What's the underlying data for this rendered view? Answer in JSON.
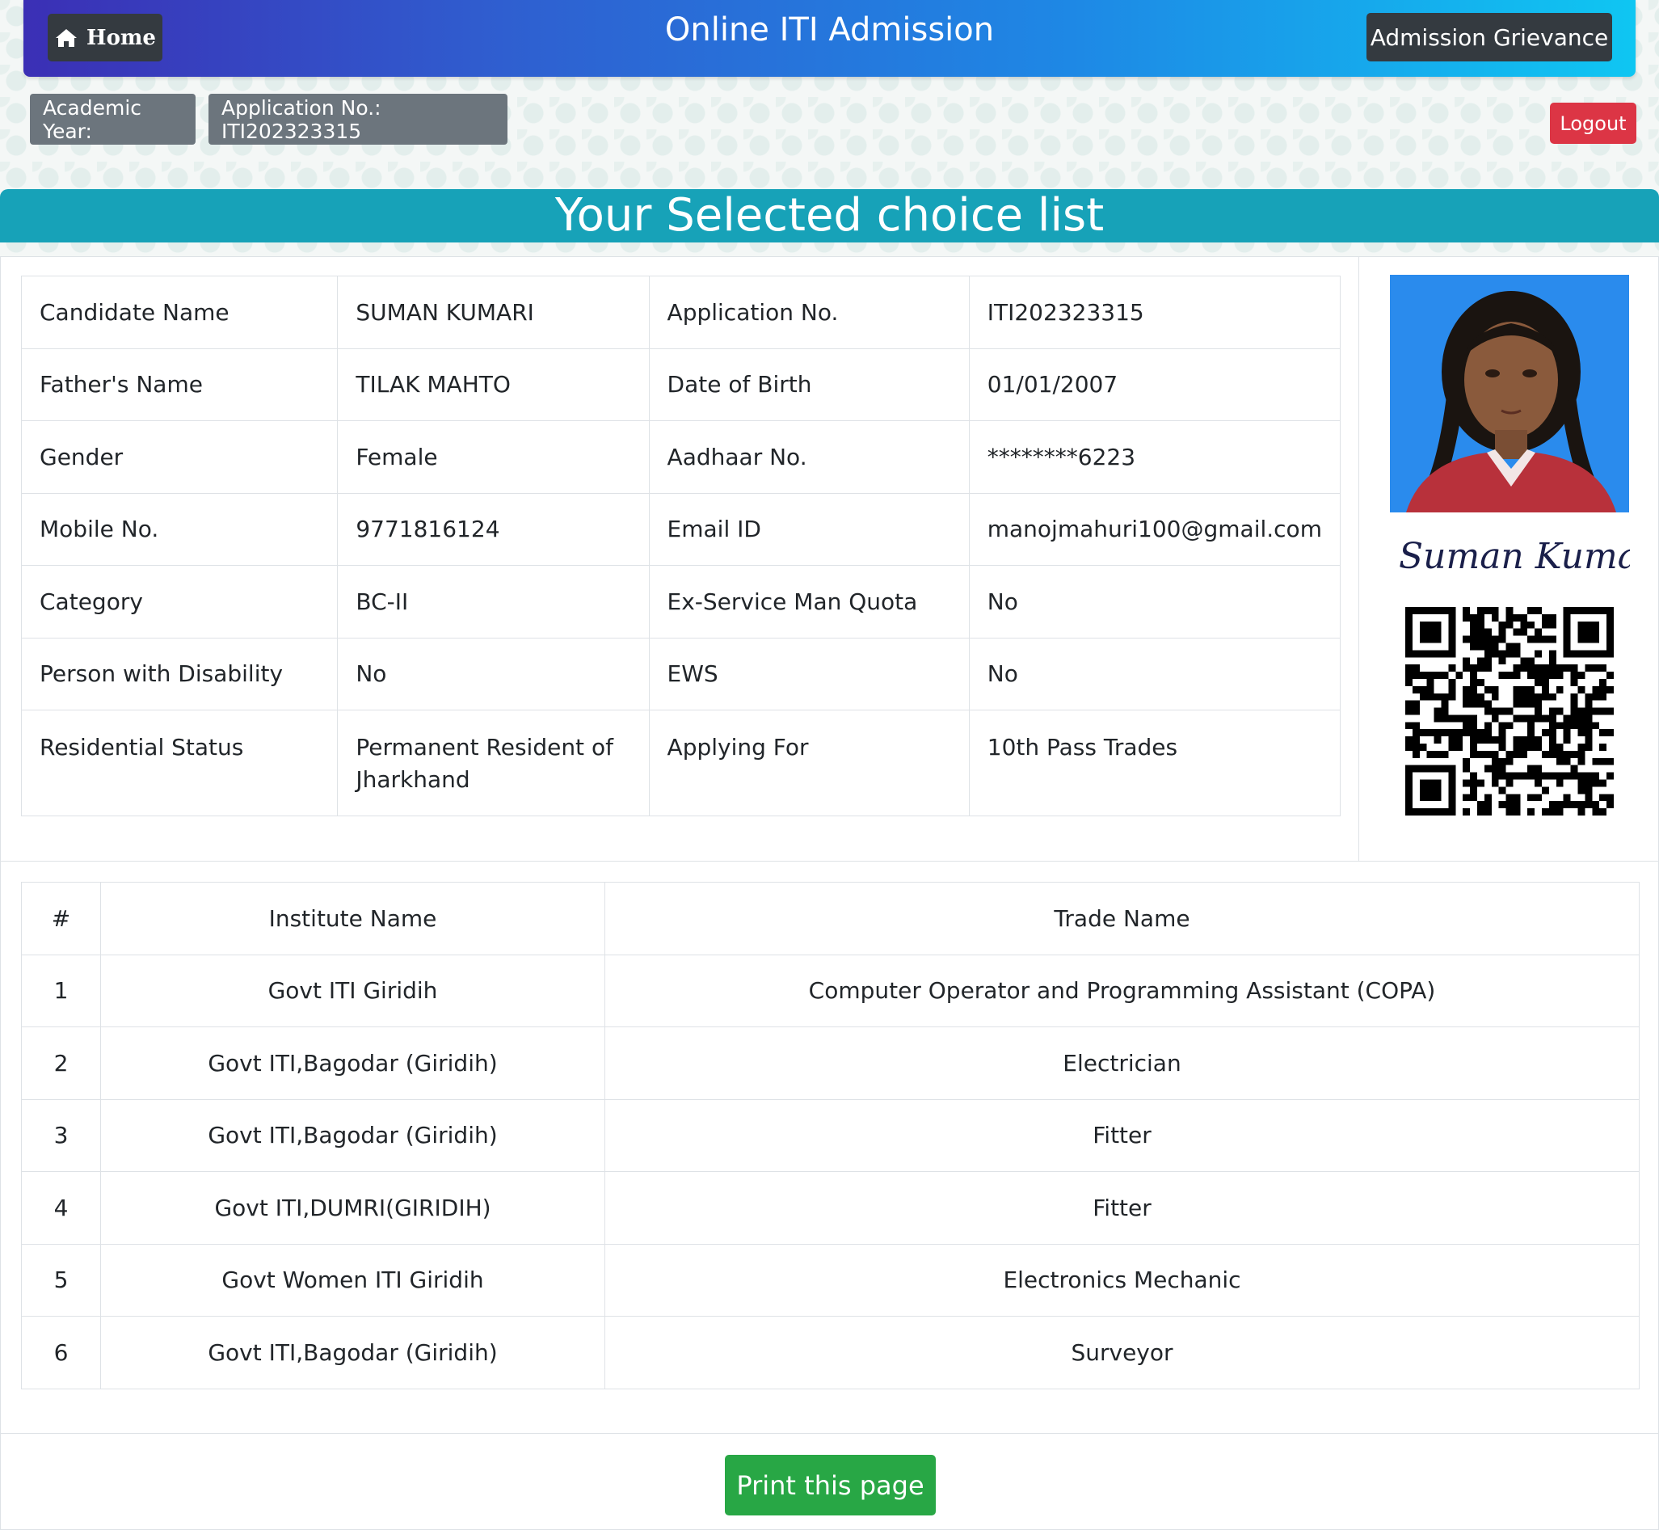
{
  "header": {
    "home_label": "Home",
    "title": "Online ITI Admission",
    "grievance_label": "Admission Grievance"
  },
  "info": {
    "academic_year": "Academic Year:",
    "application_no": "Application No.: ITI202323315",
    "logout_label": "Logout"
  },
  "banner": {
    "title": "Your Selected choice list"
  },
  "candidate": {
    "rows": [
      {
        "l1": "Candidate Name",
        "v1": "SUMAN KUMARI",
        "l2": "Application No.",
        "v2": "ITI202323315"
      },
      {
        "l1": "Father's Name",
        "v1": "TILAK MAHTO",
        "l2": "Date of Birth",
        "v2": "01/01/2007"
      },
      {
        "l1": "Gender",
        "v1": "Female",
        "l2": "Aadhaar No.",
        "v2": "********6223"
      },
      {
        "l1": "Mobile No.",
        "v1": "9771816124",
        "l2": "Email ID",
        "v2": "manojmahuri100@gmail.com"
      },
      {
        "l1": "Category",
        "v1": "BC-II",
        "l2": "Ex-Service Man Quota",
        "v2": "No"
      },
      {
        "l1": "Person with Disability",
        "v1": "No",
        "l2": "EWS",
        "v2": "No"
      },
      {
        "l1": "Residential Status",
        "v1": "Permanent Resident of Jharkhand",
        "l2": "Applying For",
        "v2": "10th Pass Trades"
      }
    ],
    "signature_text": "Suman Kumari"
  },
  "choices": {
    "headers": [
      "#",
      "Institute Name",
      "Trade Name"
    ],
    "rows": [
      [
        "1",
        "Govt ITI Giridih",
        "Computer Operator and Programming Assistant (COPA)"
      ],
      [
        "2",
        "Govt ITI,Bagodar (Giridih)",
        "Electrician"
      ],
      [
        "3",
        "Govt ITI,Bagodar (Giridih)",
        "Fitter"
      ],
      [
        "4",
        "Govt ITI,DUMRI(GIRIDIH)",
        "Fitter"
      ],
      [
        "5",
        "Govt Women ITI Giridih",
        "Electronics Mechanic"
      ],
      [
        "6",
        "Govt ITI,Bagodar (Giridih)",
        "Surveyor"
      ]
    ]
  },
  "footer": {
    "print_label": "Print this page"
  },
  "colors": {
    "banner": "#17a2b8",
    "logout": "#dc3545",
    "print": "#28a745",
    "dark_button": "#343a40",
    "badge": "#6c757d"
  },
  "icons": {
    "home": "home-icon"
  }
}
